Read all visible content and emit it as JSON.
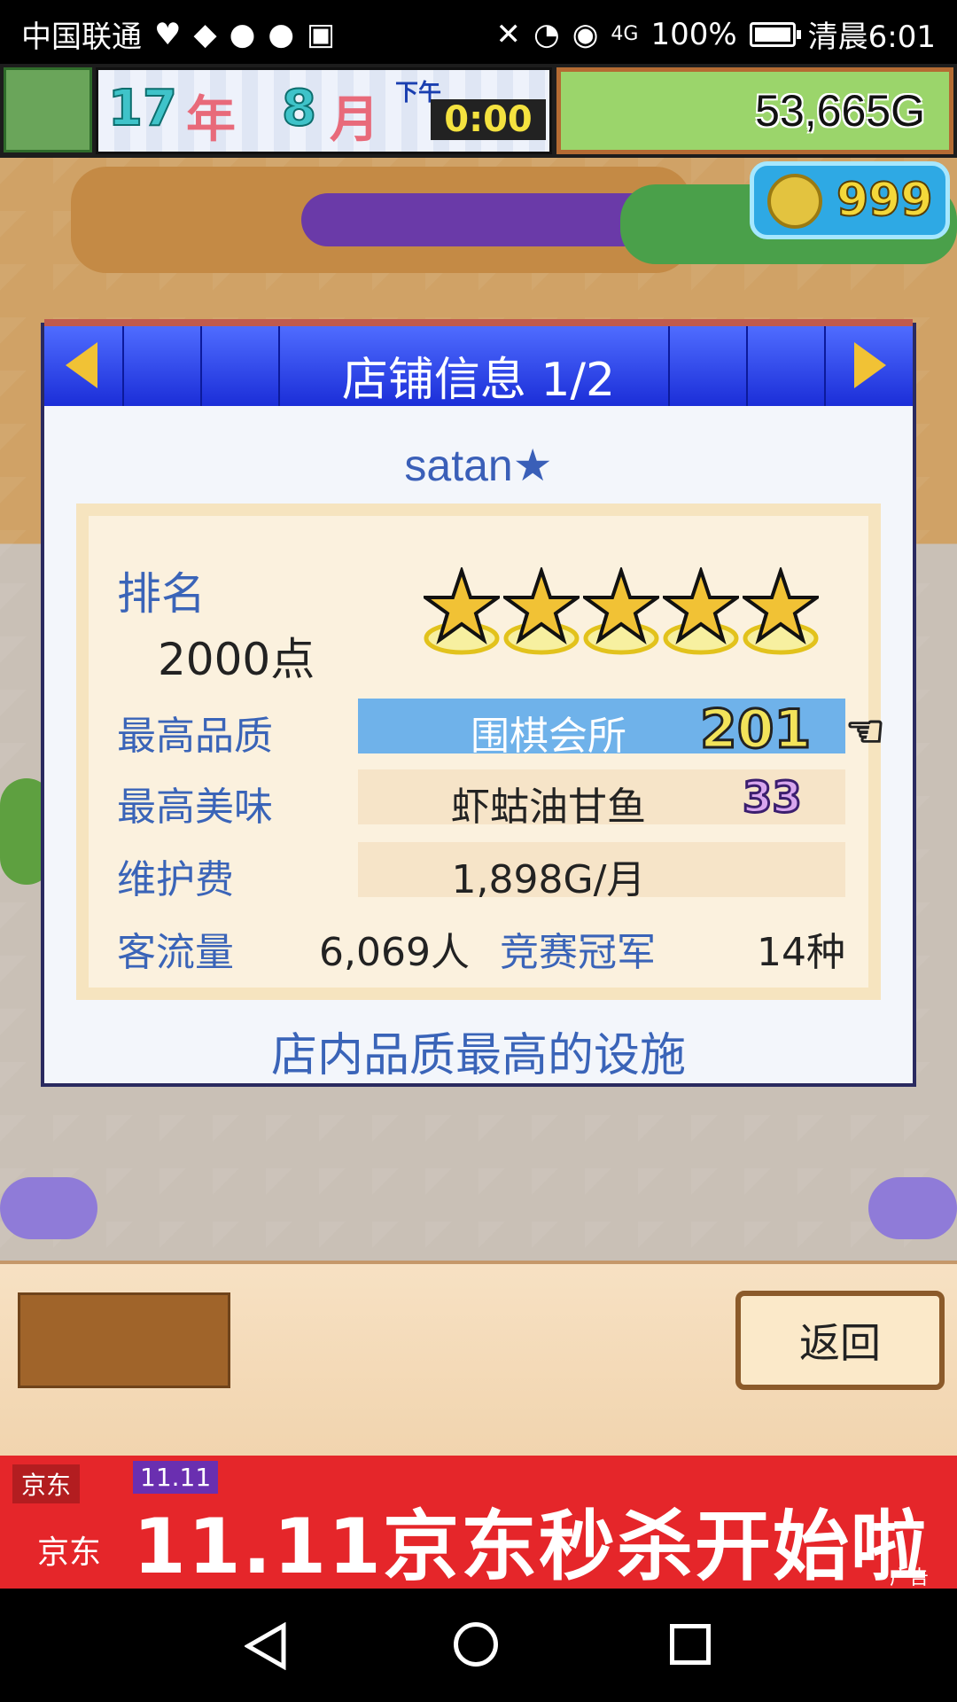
{
  "status_bar": {
    "carrier": "中国联通",
    "battery_percent": "100%",
    "time": "清晨6:01",
    "network": "4G"
  },
  "top_bar": {
    "year_num": "17",
    "year_unit": "年",
    "month_num": "8",
    "month_unit": "月",
    "ampm": "下午",
    "clock": "0:00",
    "money": "53,665G"
  },
  "coins": {
    "value": "999"
  },
  "dialog": {
    "title": "店铺信息 1/2",
    "shop_name": "satan★",
    "rank": {
      "label": "排名",
      "points": "2000点",
      "stars": 5
    },
    "rows": [
      {
        "label": "最高品质",
        "value": "围棋会所",
        "number": "201"
      },
      {
        "label": "最高美味",
        "value": "虾蛄油甘鱼",
        "number": "33"
      },
      {
        "label": "维护费",
        "value": "1,898G/月"
      }
    ],
    "traffic": {
      "label": "客流量",
      "value": "6,069人"
    },
    "champion": {
      "label": "竞赛冠军",
      "value": "14种"
    },
    "footer": "店内品质最高的设施"
  },
  "bottom": {
    "back_label": "返回"
  },
  "ad": {
    "logo": "京东",
    "tag": "11.11",
    "text": "11.11京东秒杀开始啦",
    "badge": "广告"
  },
  "colors": {
    "header_blue": "#1b2ed8",
    "label_blue": "#3a64b8",
    "star_gold": "#f1c235",
    "ad_red": "#e5262a"
  }
}
